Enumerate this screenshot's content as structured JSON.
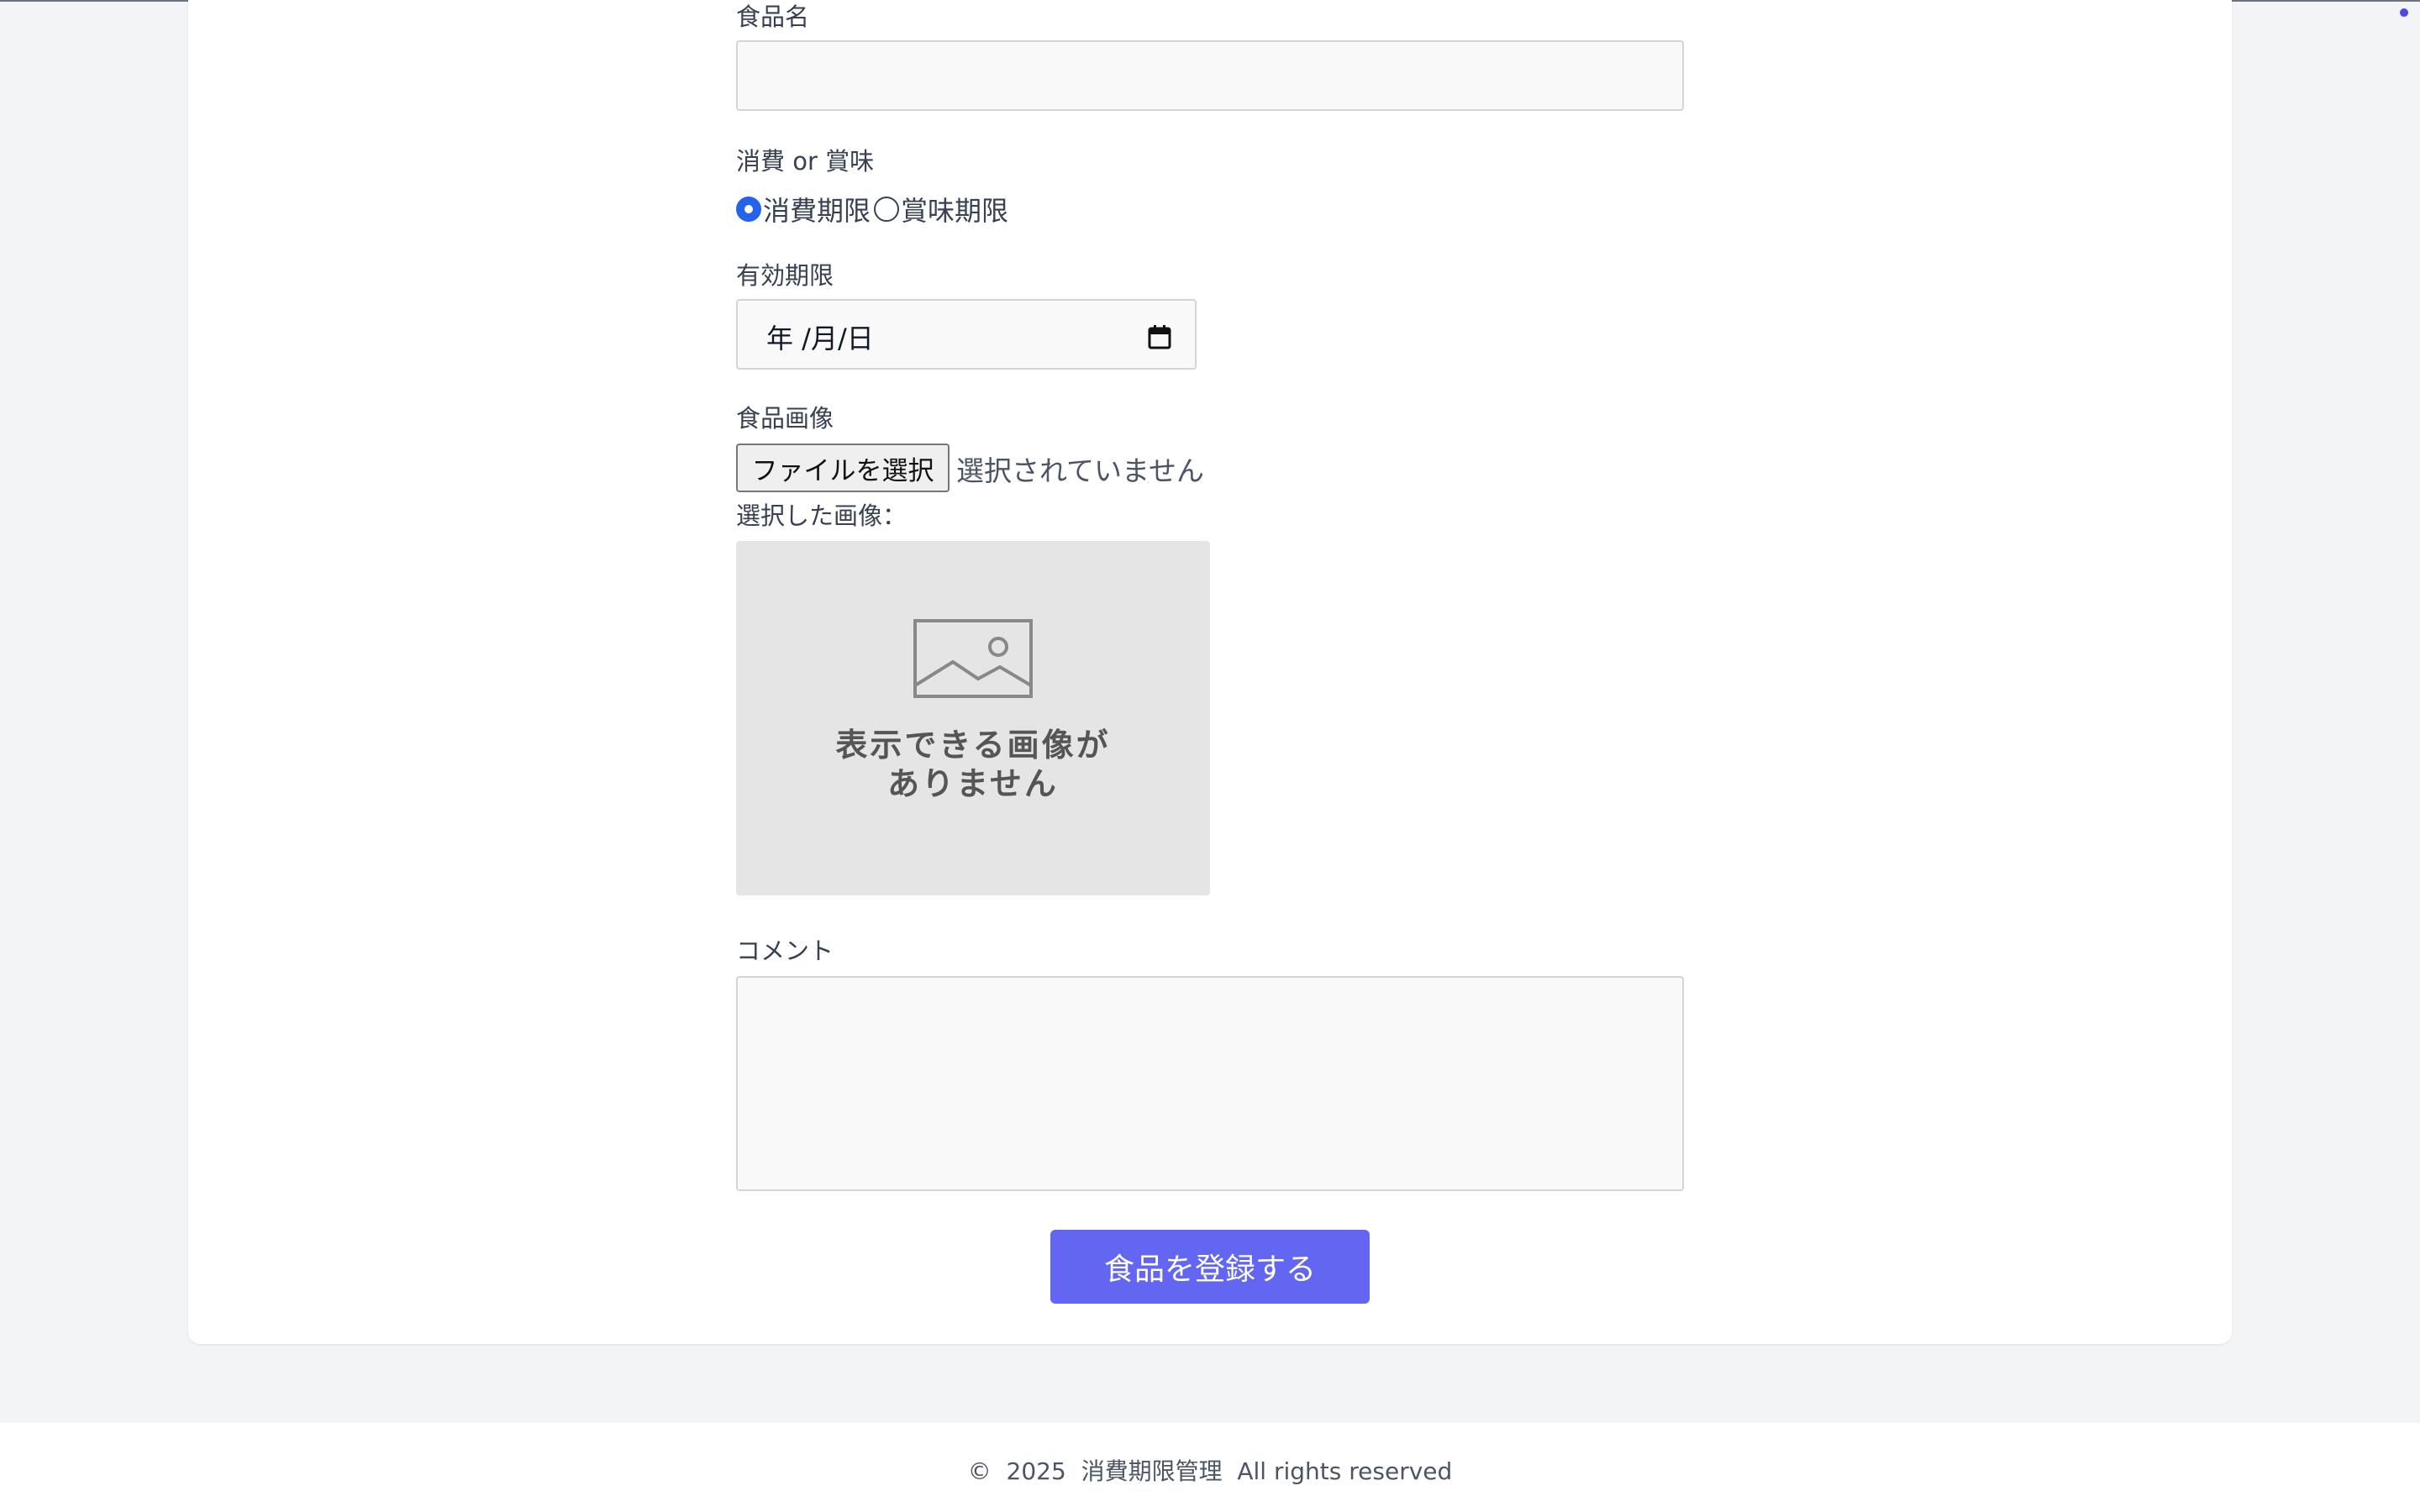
{
  "form": {
    "food_name": {
      "label": "食品名",
      "value": ""
    },
    "type": {
      "label": "消費 or 賞味",
      "options": [
        {
          "label": "消費期限",
          "checked": true
        },
        {
          "label": "賞味期限",
          "checked": false
        }
      ]
    },
    "expiry": {
      "label": "有効期限",
      "placeholder": "年 /月/日"
    },
    "image": {
      "label": "食品画像",
      "button_label": "ファイルを選択",
      "status": "選択されていません",
      "selected_label": "選択した画像：",
      "placeholder_line1": "表示できる画像が",
      "placeholder_line2": "ありません",
      "placeholder_icon": "image-placeholder-icon"
    },
    "comment": {
      "label": "コメント",
      "value": ""
    },
    "submit_label": "食品を登録する"
  },
  "footer": {
    "text": "©  2025  消費期限管理  All rights reserved"
  },
  "colors": {
    "accent": "#6366f1",
    "radio_checked": "#2563eb",
    "page_bg": "#f3f4f6"
  }
}
